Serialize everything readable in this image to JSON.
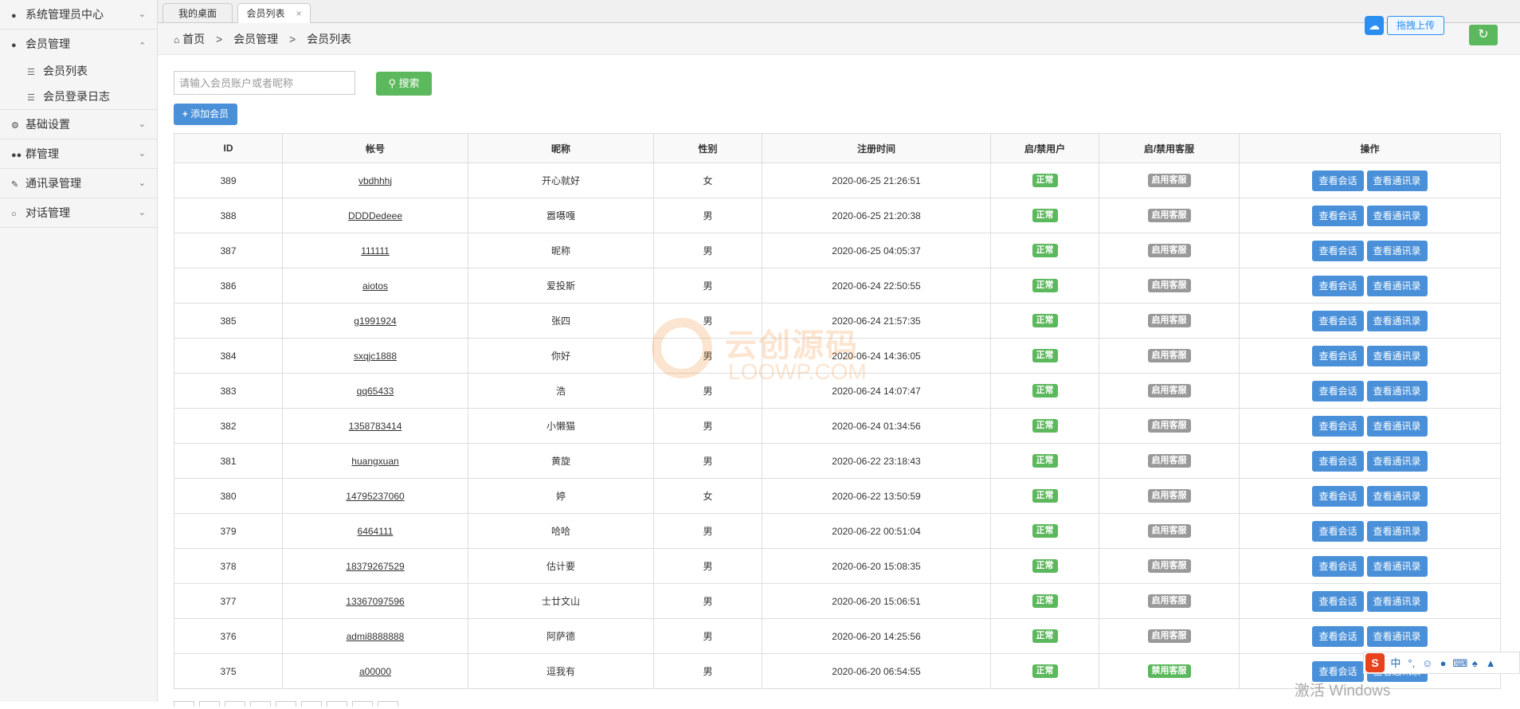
{
  "sidebar": {
    "groups": [
      {
        "label": "系统管理员中心",
        "icon": "user-icon",
        "expanded": false
      },
      {
        "label": "会员管理",
        "icon": "user-icon",
        "expanded": true,
        "items": [
          {
            "label": "会员列表",
            "icon": "list-icon"
          },
          {
            "label": "会员登录日志",
            "icon": "list-icon"
          }
        ]
      },
      {
        "label": "基础设置",
        "icon": "gear-icon",
        "expanded": false
      },
      {
        "label": "群管理",
        "icon": "group-icon",
        "expanded": false
      },
      {
        "label": "通讯录管理",
        "icon": "edit-icon",
        "expanded": false
      },
      {
        "label": "对话管理",
        "icon": "chat-icon",
        "expanded": false
      }
    ]
  },
  "tabs": [
    {
      "label": "我的桌面",
      "active": false
    },
    {
      "label": "会员列表",
      "active": true,
      "close": "×"
    }
  ],
  "breadcrumb": {
    "home": "首页",
    "sep": ">",
    "items": [
      "会员管理",
      "会员列表"
    ]
  },
  "upload": {
    "label": "拖拽上传"
  },
  "search": {
    "placeholder": "请输入会员账户或者昵称",
    "button": "搜索"
  },
  "add_button": "添加会员",
  "table": {
    "headers": [
      "ID",
      "帐号",
      "昵称",
      "性别",
      "注册时间",
      "启/禁用户",
      "启/禁用客服",
      "操作"
    ],
    "action_labels": {
      "session": "查看会话",
      "contacts": "查看通讯录"
    },
    "rows": [
      {
        "id": "389",
        "account": "vbdhhhj",
        "nickname": "开心就好",
        "gender": "女",
        "time": "2020-06-25 21:26:51",
        "user_status": "正常",
        "service_status": "启用客服",
        "service_active": false
      },
      {
        "id": "388",
        "account": "DDDDedeee",
        "nickname": "嚣嗫嘎",
        "gender": "男",
        "time": "2020-06-25 21:20:38",
        "user_status": "正常",
        "service_status": "启用客服",
        "service_active": false
      },
      {
        "id": "387",
        "account": "111111",
        "nickname": "昵称",
        "gender": "男",
        "time": "2020-06-25 04:05:37",
        "user_status": "正常",
        "service_status": "启用客服",
        "service_active": false
      },
      {
        "id": "386",
        "account": "aiotos",
        "nickname": "爱投斯",
        "gender": "男",
        "time": "2020-06-24 22:50:55",
        "user_status": "正常",
        "service_status": "启用客服",
        "service_active": false
      },
      {
        "id": "385",
        "account": "g1991924",
        "nickname": "张四",
        "gender": "男",
        "time": "2020-06-24 21:57:35",
        "user_status": "正常",
        "service_status": "启用客服",
        "service_active": false
      },
      {
        "id": "384",
        "account": "sxqjc1888",
        "nickname": "你好",
        "gender": "男",
        "time": "2020-06-24 14:36:05",
        "user_status": "正常",
        "service_status": "启用客服",
        "service_active": false
      },
      {
        "id": "383",
        "account": "qq65433",
        "nickname": "浩",
        "gender": "男",
        "time": "2020-06-24 14:07:47",
        "user_status": "正常",
        "service_status": "启用客服",
        "service_active": false
      },
      {
        "id": "382",
        "account": "1358783414",
        "nickname": "小懒猫",
        "gender": "男",
        "time": "2020-06-24 01:34:56",
        "user_status": "正常",
        "service_status": "启用客服",
        "service_active": false
      },
      {
        "id": "381",
        "account": "huangxuan",
        "nickname": "黄旋",
        "gender": "男",
        "time": "2020-06-22 23:18:43",
        "user_status": "正常",
        "service_status": "启用客服",
        "service_active": false
      },
      {
        "id": "380",
        "account": "14795237060",
        "nickname": "婷",
        "gender": "女",
        "time": "2020-06-22 13:50:59",
        "user_status": "正常",
        "service_status": "启用客服",
        "service_active": false
      },
      {
        "id": "379",
        "account": "6464111",
        "nickname": "哈哈",
        "gender": "男",
        "time": "2020-06-22 00:51:04",
        "user_status": "正常",
        "service_status": "启用客服",
        "service_active": false
      },
      {
        "id": "378",
        "account": "18379267529",
        "nickname": "估计要",
        "gender": "男",
        "time": "2020-06-20 15:08:35",
        "user_status": "正常",
        "service_status": "启用客服",
        "service_active": false
      },
      {
        "id": "377",
        "account": "13367097596",
        "nickname": "士廿文山",
        "gender": "男",
        "time": "2020-06-20 15:06:51",
        "user_status": "正常",
        "service_status": "启用客服",
        "service_active": false
      },
      {
        "id": "376",
        "account": "admi8888888",
        "nickname": "阿萨德",
        "gender": "男",
        "time": "2020-06-20 14:25:56",
        "user_status": "正常",
        "service_status": "启用客服",
        "service_active": false
      },
      {
        "id": "375",
        "account": "a00000",
        "nickname": "逗我有",
        "gender": "男",
        "time": "2020-06-20 06:54:55",
        "user_status": "正常",
        "service_status": "禁用客服",
        "service_active": true
      }
    ]
  },
  "watermark": {
    "title": "云创源码",
    "subtitle": "LOOWP.COM"
  },
  "ime": {
    "logo": "S",
    "mode": "中"
  },
  "os_notice": "激活 Windows",
  "colors": {
    "green": "#5cb85c",
    "blue": "#4a90d9",
    "gray": "#999999"
  }
}
